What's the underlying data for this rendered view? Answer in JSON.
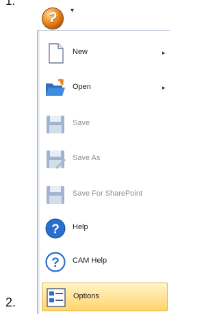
{
  "step_numbers": {
    "top": "1.",
    "bottom": "2."
  },
  "qat": {
    "arrow": "▾"
  },
  "menu": {
    "items": [
      {
        "label": "New",
        "icon": "new-document-icon",
        "enabled": true,
        "submenu": true
      },
      {
        "label": "Open",
        "icon": "open-folder-icon",
        "enabled": true,
        "submenu": true
      },
      {
        "label": "Save",
        "icon": "save-icon",
        "enabled": false,
        "submenu": false
      },
      {
        "label": "Save As",
        "icon": "save-as-icon",
        "enabled": false,
        "submenu": false
      },
      {
        "label": "Save For SharePoint",
        "icon": "save-sharepoint-icon",
        "enabled": false,
        "submenu": false
      },
      {
        "label": "Help",
        "icon": "help-icon",
        "enabled": true,
        "submenu": false
      },
      {
        "label": "CAM Help",
        "icon": "cam-help-icon",
        "enabled": true,
        "submenu": false
      },
      {
        "label": "Options",
        "icon": "options-icon",
        "enabled": true,
        "submenu": false,
        "selected": true
      }
    ],
    "submenu_arrow": "▸"
  },
  "colors": {
    "orb": "#f59a2e",
    "selection_top": "#fff3c8",
    "selection_bottom": "#ffd56c",
    "help_blue": "#2a6fd0",
    "disabled_text": "#8d8d8d"
  }
}
